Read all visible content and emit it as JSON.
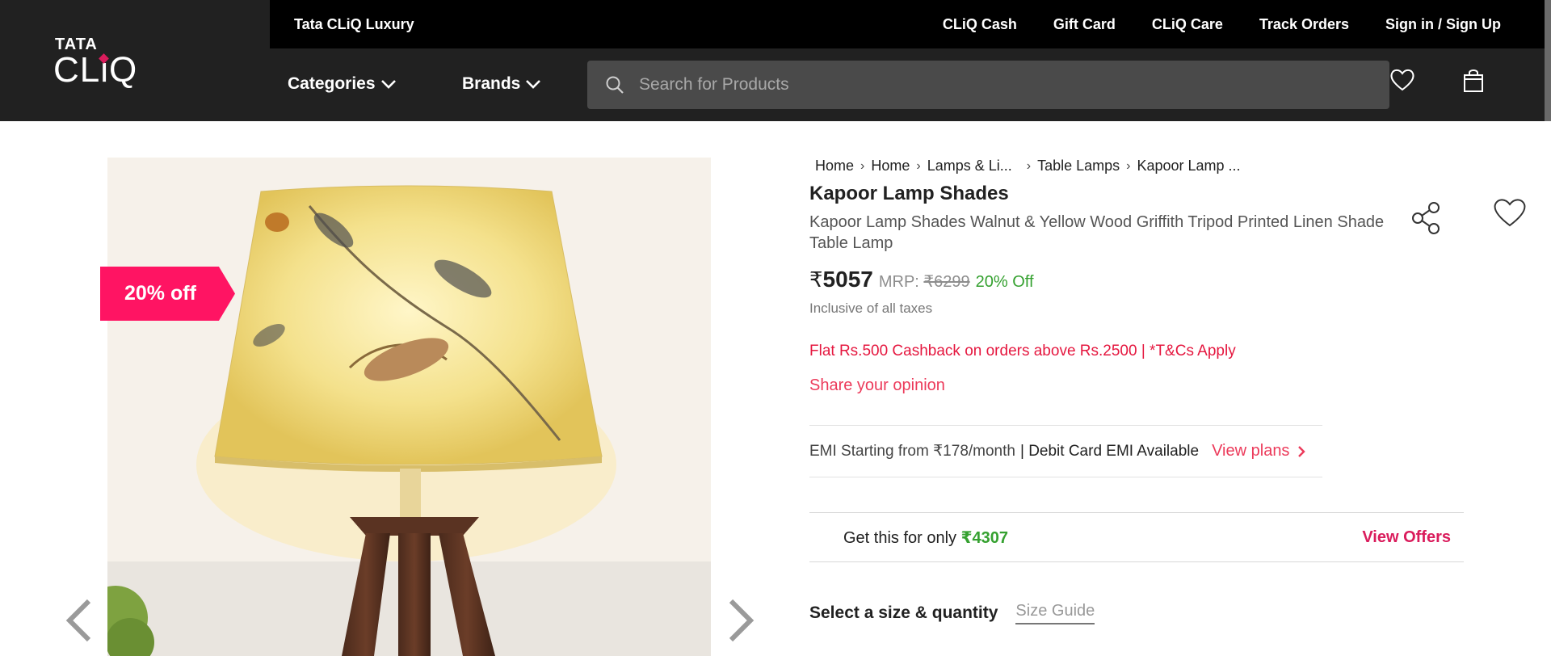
{
  "header": {
    "logo_top": "TATA",
    "logo_main": "CLiQ",
    "luxury_link": "Tata CLiQ Luxury",
    "top_links": [
      "CLiQ Cash",
      "Gift Card",
      "CLiQ Care",
      "Track Orders",
      "Sign in / Sign Up"
    ],
    "categories_label": "Categories",
    "brands_label": "Brands",
    "search_placeholder": "Search for Products"
  },
  "gallery": {
    "discount_tag": "20% off"
  },
  "breadcrumb": [
    "Home",
    "Home",
    "Lamps & Li...",
    "Table Lamps",
    "Kapoor Lamp ..."
  ],
  "product": {
    "brand": "Kapoor Lamp Shades",
    "name": "Kapoor Lamp Shades Walnut & Yellow Wood Griffith Tripod Printed Linen Shade Table Lamp",
    "currency": "₹",
    "price": "5057",
    "mrp_label": "MRP:",
    "mrp": "₹6299",
    "discount": "20% Off",
    "tax_note": "Inclusive of all taxes",
    "cashback": "Flat Rs.500 Cashback on orders above Rs.2500 | *T&Cs Apply",
    "opinion": "Share your opinion",
    "emi_text": "EMI Starting from ₹178/month",
    "emi_debit": "| Debit Card EMI Available",
    "emi_link": "View plans",
    "offer_text": "Get this for only ",
    "offer_amount": "₹4307",
    "offer_link": "View Offers",
    "size_label": "Select a size & quantity",
    "size_guide": "Size Guide"
  },
  "colors": {
    "header_bg": "#212121",
    "accent_pink": "#da1c5c",
    "discount_tag": "#ff1463",
    "green": "#35a130"
  }
}
